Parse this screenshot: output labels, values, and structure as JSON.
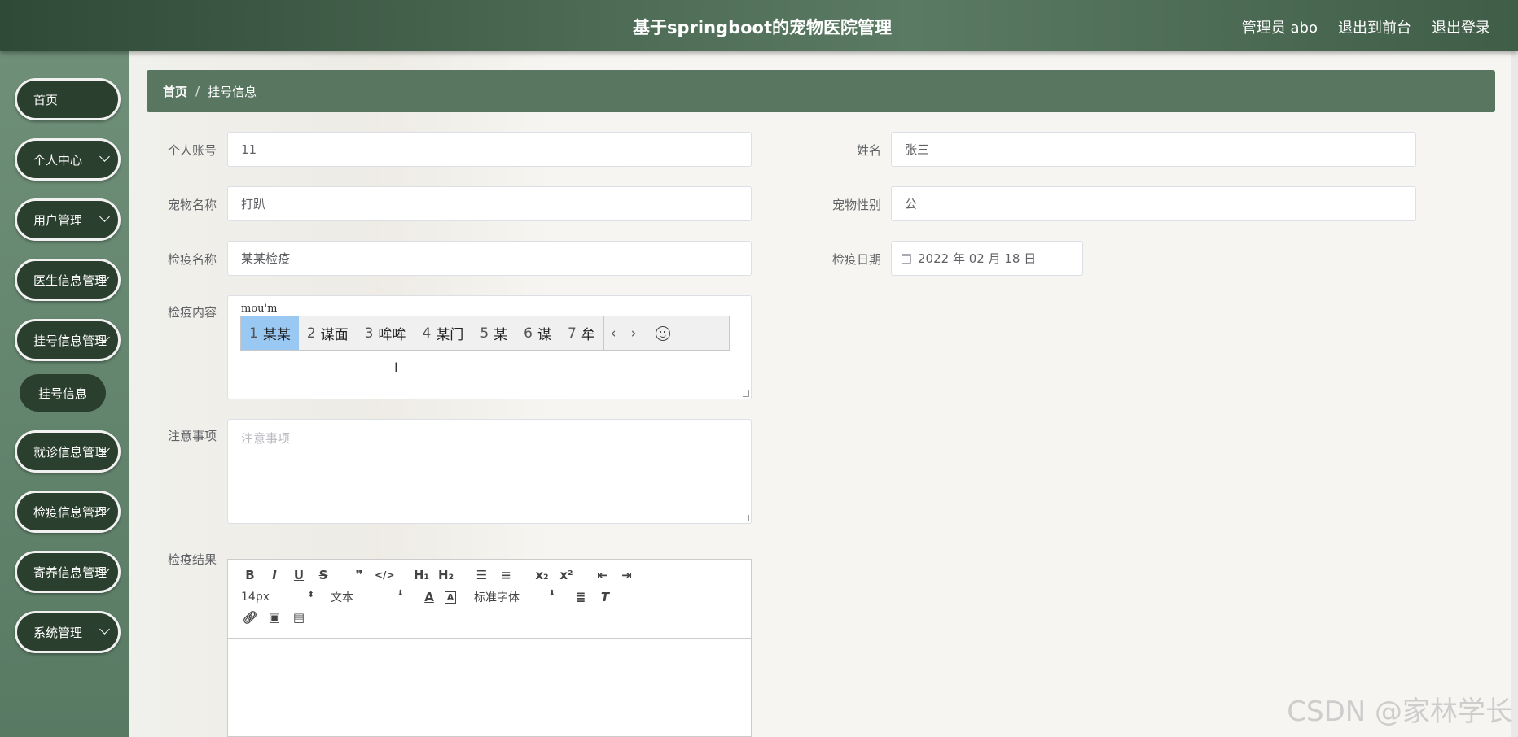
{
  "header": {
    "title": "基于springboot的宠物医院管理",
    "admin_label": "管理员 abo",
    "front_label": "退出到前台",
    "logout_label": "退出登录"
  },
  "sidebar": {
    "items": [
      {
        "label": "首页"
      },
      {
        "label": "个人中心"
      },
      {
        "label": "用户管理"
      },
      {
        "label": "医生信息管理"
      },
      {
        "label": "挂号信息管理"
      },
      {
        "label": "就诊信息管理"
      },
      {
        "label": "检疫信息管理"
      },
      {
        "label": "寄养信息管理"
      },
      {
        "label": "系统管理"
      }
    ],
    "sub_item": "挂号信息"
  },
  "breadcrumb": {
    "home": "首页",
    "sep": "/",
    "current": "挂号信息"
  },
  "form": {
    "account_label": "个人账号",
    "account_value": "11",
    "name_label": "姓名",
    "name_value": "张三",
    "pet_label": "宠物名称",
    "pet_value": "打趴",
    "gender_label": "宠物性别",
    "gender_value": "公",
    "quarantine_name_label": "检疫名称",
    "quarantine_name_value": "某某检疫",
    "date_label": "检疫日期",
    "date_value": "2022 年 02 月 18 日",
    "content_label": "检疫内容",
    "notes_label": "注意事项",
    "notes_placeholder": "注意事项",
    "result_label": "检疫结果"
  },
  "ime": {
    "composition": "mou'm",
    "candidates": [
      {
        "num": "1",
        "text": "某某"
      },
      {
        "num": "2",
        "text": "谋面"
      },
      {
        "num": "3",
        "text": "哞哞"
      },
      {
        "num": "4",
        "text": "某门"
      },
      {
        "num": "5",
        "text": "某"
      },
      {
        "num": "6",
        "text": "谋"
      },
      {
        "num": "7",
        "text": "牟"
      }
    ],
    "prev": "‹",
    "next": "›"
  },
  "editor": {
    "font_size": "14px",
    "text_type": "文本",
    "font_family": "标准字体"
  },
  "watermark": "CSDN @家林学长"
}
